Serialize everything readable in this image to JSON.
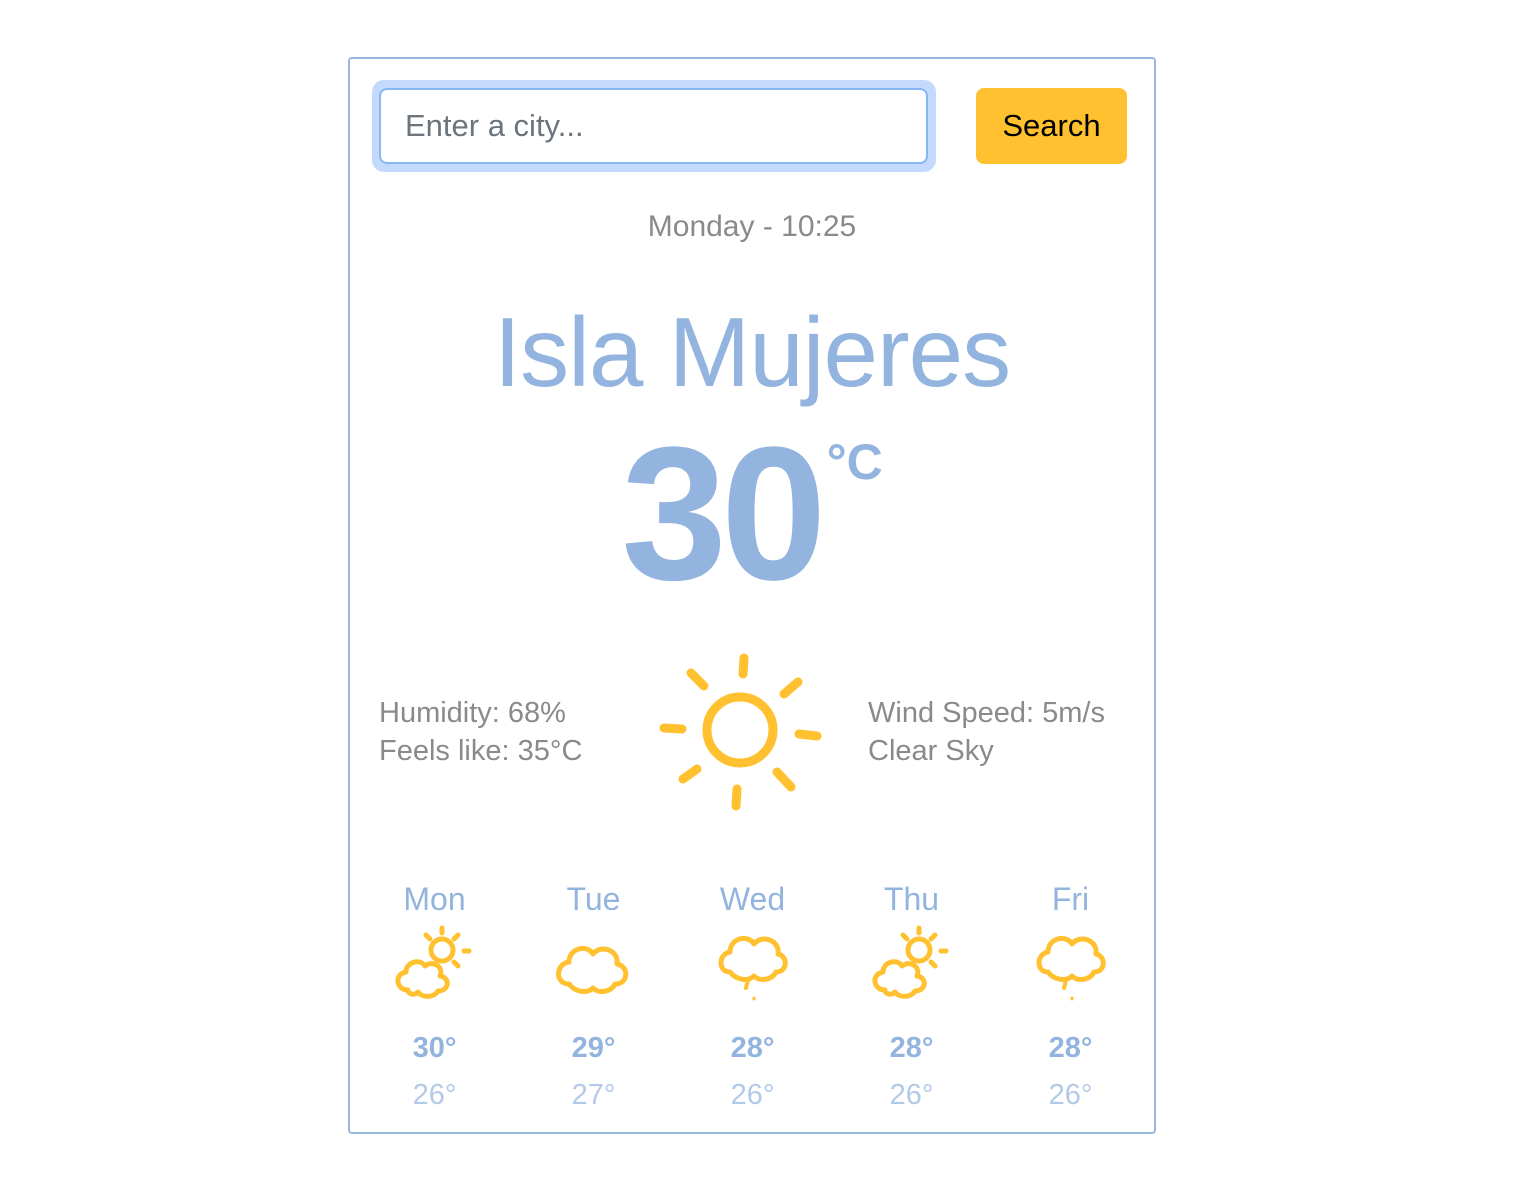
{
  "search": {
    "placeholder": "Enter a city...",
    "button_label": "Search"
  },
  "current": {
    "datetime": "Monday - 10:25",
    "city": "Isla Mujeres",
    "temperature": "30",
    "unit": "°C",
    "humidity": "Humidity: 68%",
    "feels_like": "Feels like: 35°C",
    "wind_speed": "Wind Speed: 5m/s",
    "description": "Clear Sky",
    "icon": "sun-icon"
  },
  "forecast": [
    {
      "day": "Mon",
      "max": "30°",
      "min": "26°",
      "icon": "partly-cloudy-icon"
    },
    {
      "day": "Tue",
      "max": "29°",
      "min": "27°",
      "icon": "cloud-icon"
    },
    {
      "day": "Wed",
      "max": "28°",
      "min": "26°",
      "icon": "light-rain-cloud-icon"
    },
    {
      "day": "Thu",
      "max": "28°",
      "min": "26°",
      "icon": "partly-cloudy-icon"
    },
    {
      "day": "Fri",
      "max": "28°",
      "min": "26°",
      "icon": "light-rain-cloud-icon"
    }
  ],
  "colors": {
    "accent": "#93b4de",
    "button": "#ffc130",
    "icon": "#ffc130",
    "muted_text": "#8a8a8a"
  }
}
